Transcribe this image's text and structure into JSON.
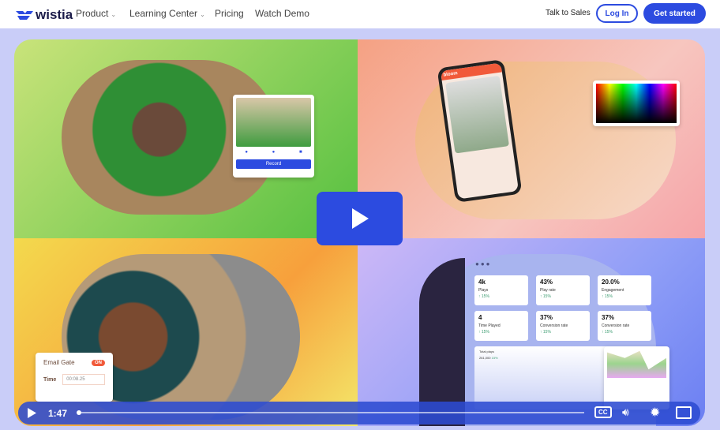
{
  "nav": {
    "brand": "wistia",
    "items": [
      {
        "label": "Product",
        "dropdown": true
      },
      {
        "label": "Learning Center",
        "dropdown": true
      },
      {
        "label": "Pricing"
      },
      {
        "label": "Watch Demo"
      }
    ],
    "talk_to_sales": "Talk to Sales",
    "login": "Log In",
    "get_started": "Get started"
  },
  "video": {
    "record_card": {
      "button": "Record"
    },
    "app_name": "bloom",
    "email_gate": {
      "label": "Email Gate",
      "toggle": "ON",
      "time_label": "Time",
      "time_value": "00:08.25"
    },
    "stats": [
      {
        "value": "4k",
        "label": "Plays",
        "delta": "15%"
      },
      {
        "value": "43%",
        "label": "Play rate",
        "delta": "15%"
      },
      {
        "value": "20.0%",
        "label": "Engagement",
        "delta": "15%"
      },
      {
        "value": "4",
        "label": "Time Played",
        "delta": "15%"
      },
      {
        "value": "37%",
        "label": "Conversion rate",
        "delta": "15%"
      },
      {
        "value": "37%",
        "label": "Conversion rate",
        "delta": "15%"
      }
    ],
    "total_plays": {
      "title": "Total plays",
      "value": "261,000",
      "delta": "15%"
    },
    "controls": {
      "time": "1:47",
      "progress": 0.0,
      "cc": "CC"
    },
    "colors": {
      "accent": "#2c4be0"
    }
  }
}
